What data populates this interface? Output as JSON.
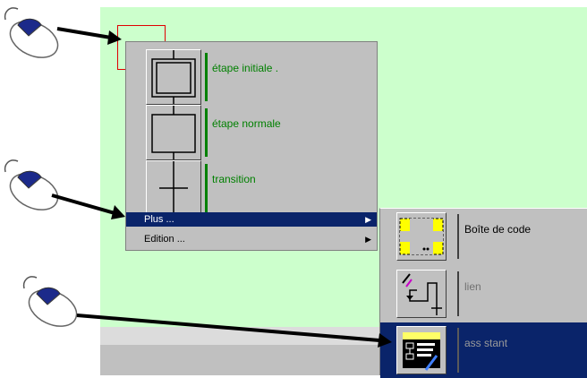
{
  "context_menu": {
    "tools": [
      {
        "label": "étape initiale ."
      },
      {
        "label": "étape normale"
      },
      {
        "label": "transition"
      }
    ],
    "items": [
      {
        "label": "Plus ..."
      },
      {
        "label": "Edition ..."
      }
    ]
  },
  "submenu": {
    "items": [
      {
        "label": "Boîte de code"
      },
      {
        "label": "lien"
      },
      {
        "label": "ass stant"
      }
    ]
  },
  "colors": {
    "workspace": "#ccffcc",
    "menu": "#c0c0c0",
    "highlight": "#0a246a",
    "tool_label": "#008000"
  }
}
